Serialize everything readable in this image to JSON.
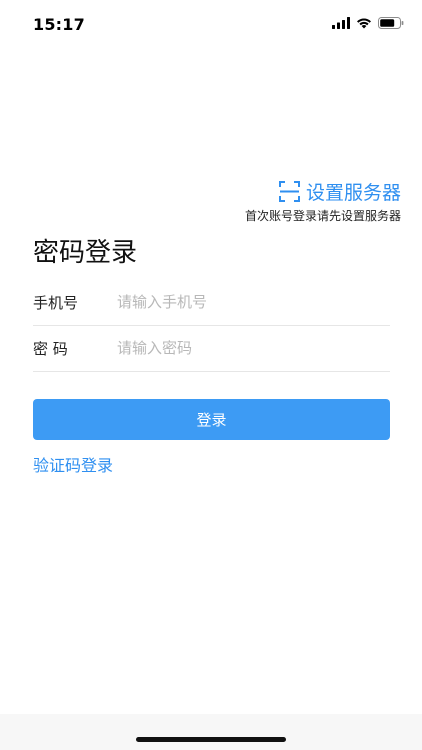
{
  "status_bar": {
    "time": "15:17"
  },
  "server": {
    "link_label": "设置服务器",
    "hint": "首次账号登录请先设置服务器",
    "icon": "scan-icon"
  },
  "login": {
    "title": "密码登录",
    "phone_label": "手机号",
    "phone_placeholder": "请输入手机号",
    "phone_value": "",
    "password_label": "密 码",
    "password_placeholder": "请输入密码",
    "password_value": "",
    "submit_label": "登录",
    "alt_login_label": "验证码登录"
  },
  "colors": {
    "accent": "#2f8ff0",
    "button": "#3d9bf4"
  }
}
